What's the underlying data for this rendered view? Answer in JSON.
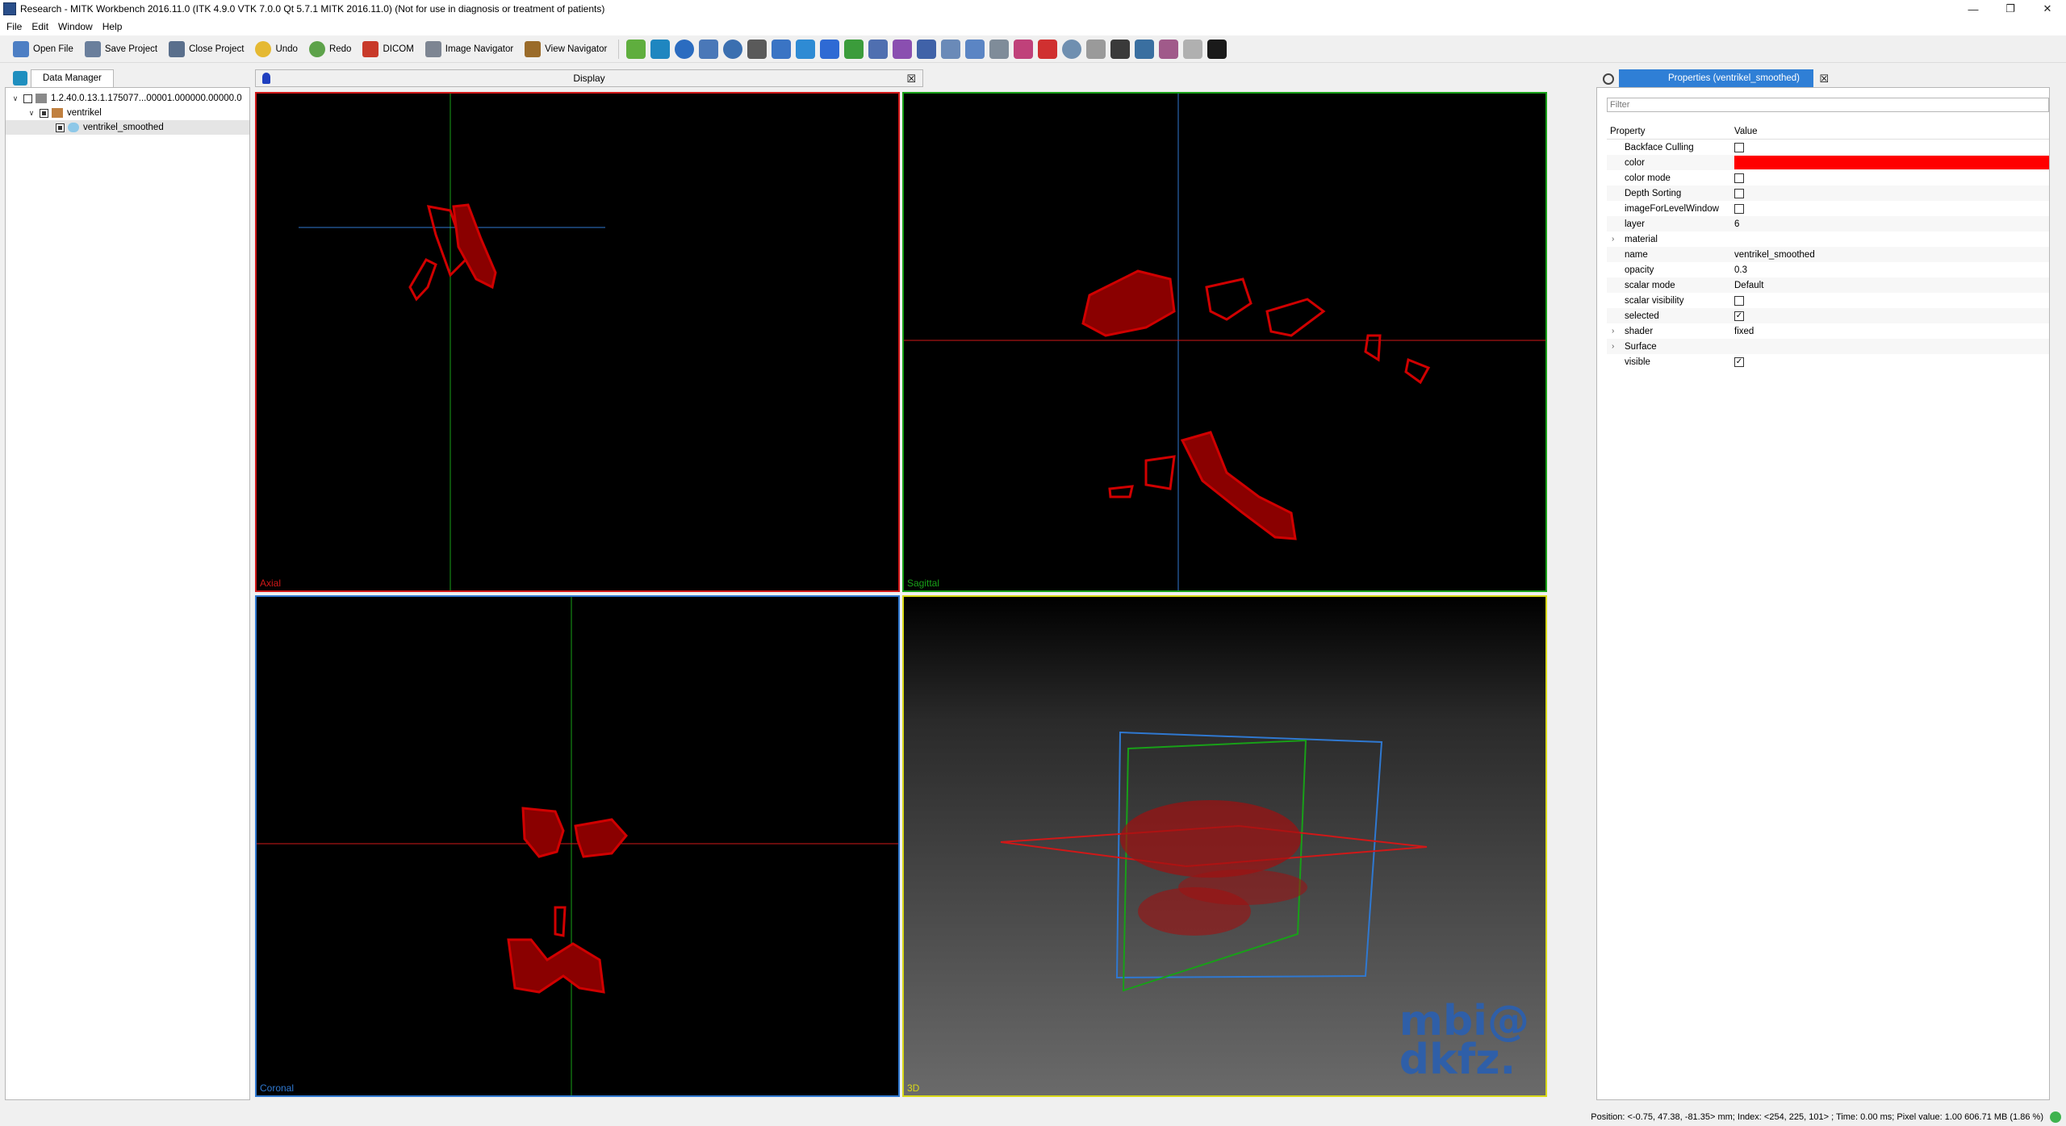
{
  "window": {
    "title": "Research - MITK Workbench 2016.11.0 (ITK 4.9.0  VTK 7.0.0 Qt 5.7.1 MITK 2016.11.0) (Not for use in diagnosis or treatment of patients)"
  },
  "menu": [
    "File",
    "Edit",
    "Window",
    "Help"
  ],
  "toolbar": {
    "open_file": "Open File",
    "save_project": "Save Project",
    "close_project": "Close Project",
    "undo": "Undo",
    "redo": "Redo",
    "dicom": "DICOM",
    "image_navigator": "Image Navigator",
    "view_navigator": "View Navigator"
  },
  "data_manager": {
    "tab": "Data Manager",
    "items": [
      {
        "label": "1.2.40.0.13.1.175077...00001.000000.00000.0"
      },
      {
        "label": "ventrikel"
      },
      {
        "label": "ventrikel_smoothed"
      }
    ]
  },
  "display": {
    "title": "Display",
    "axial_label": "Axial",
    "sagittal_label": "Sagittal",
    "coronal_label": "Coronal",
    "threed_label": "3D",
    "watermark_line1": "mbi@",
    "watermark_line2": "dkfz."
  },
  "properties": {
    "tab": "Properties (ventrikel_smoothed)",
    "filter_placeholder": "Filter",
    "col_property": "Property",
    "col_value": "Value",
    "rows": [
      {
        "name": "Backface Culling",
        "type": "checkbox",
        "checked": false
      },
      {
        "name": "color",
        "type": "color",
        "value": "#ff0000"
      },
      {
        "name": "color mode",
        "type": "checkbox",
        "checked": false
      },
      {
        "name": "Depth Sorting",
        "type": "checkbox",
        "checked": false
      },
      {
        "name": "imageForLevelWindow",
        "type": "checkbox",
        "checked": false
      },
      {
        "name": "layer",
        "type": "text",
        "value": "6"
      },
      {
        "name": "material",
        "type": "group",
        "value": ""
      },
      {
        "name": "name",
        "type": "text",
        "value": "ventrikel_smoothed"
      },
      {
        "name": "opacity",
        "type": "text",
        "value": "0.3"
      },
      {
        "name": "scalar mode",
        "type": "text",
        "value": "Default"
      },
      {
        "name": "scalar visibility",
        "type": "checkbox",
        "checked": false
      },
      {
        "name": "selected",
        "type": "checkbox",
        "checked": true
      },
      {
        "name": "shader",
        "type": "group",
        "value": "fixed"
      },
      {
        "name": "Surface",
        "type": "group",
        "value": ""
      },
      {
        "name": "visible",
        "type": "checkbox",
        "checked": true
      }
    ]
  },
  "status": {
    "text": "Position: <-0.75, 47.38, -81.35> mm; Index: <254, 225, 101> ; Time: 0.00 ms; Pixel value: 1.00  606.71 MB (1.86 %)"
  },
  "colors": {
    "axial": "#d01818",
    "sagittal": "#18a018",
    "coronal": "#2f78d0",
    "threed": "#d8d818",
    "segmentation": "#d00000"
  }
}
